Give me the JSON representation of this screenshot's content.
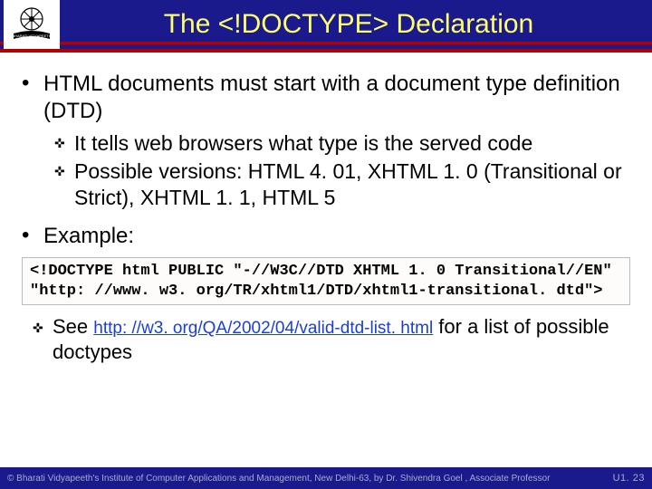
{
  "title": "The <!DOCTYPE> Declaration",
  "bullets": {
    "b1": "HTML documents must start with a document type definition (DTD)",
    "sub1": "It tells web browsers what type is the served code",
    "sub2": "Possible versions: HTML 4. 01, XHTML 1. 0 (Transitional or Strict), XHTML 1. 1, HTML 5",
    "b2": "Example:"
  },
  "code": "<!DOCTYPE html PUBLIC \"-//W3C//DTD XHTML 1. 0 Transitional//EN\" \"http: //www. w3. org/TR/xhtml1/DTD/xhtml1-transitional. dtd\">",
  "see": {
    "prefix": "See ",
    "link": "http: //w3. org/QA/2002/04/valid-dtd-list. html",
    "suffix": " for a list of possible doctypes"
  },
  "footer": {
    "left": "© Bharati Vidyapeeth's Institute of Computer Applications and Management, New Delhi-63, by Dr. Shivendra Goel , Associate Professor",
    "right": "U1. 23"
  }
}
